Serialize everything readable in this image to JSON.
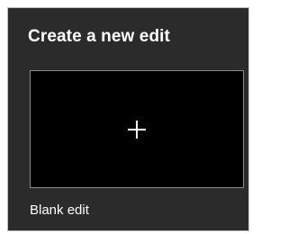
{
  "panel": {
    "title": "Create a new edit",
    "tile": {
      "icon": "plus-icon",
      "caption": "Blank edit"
    }
  }
}
